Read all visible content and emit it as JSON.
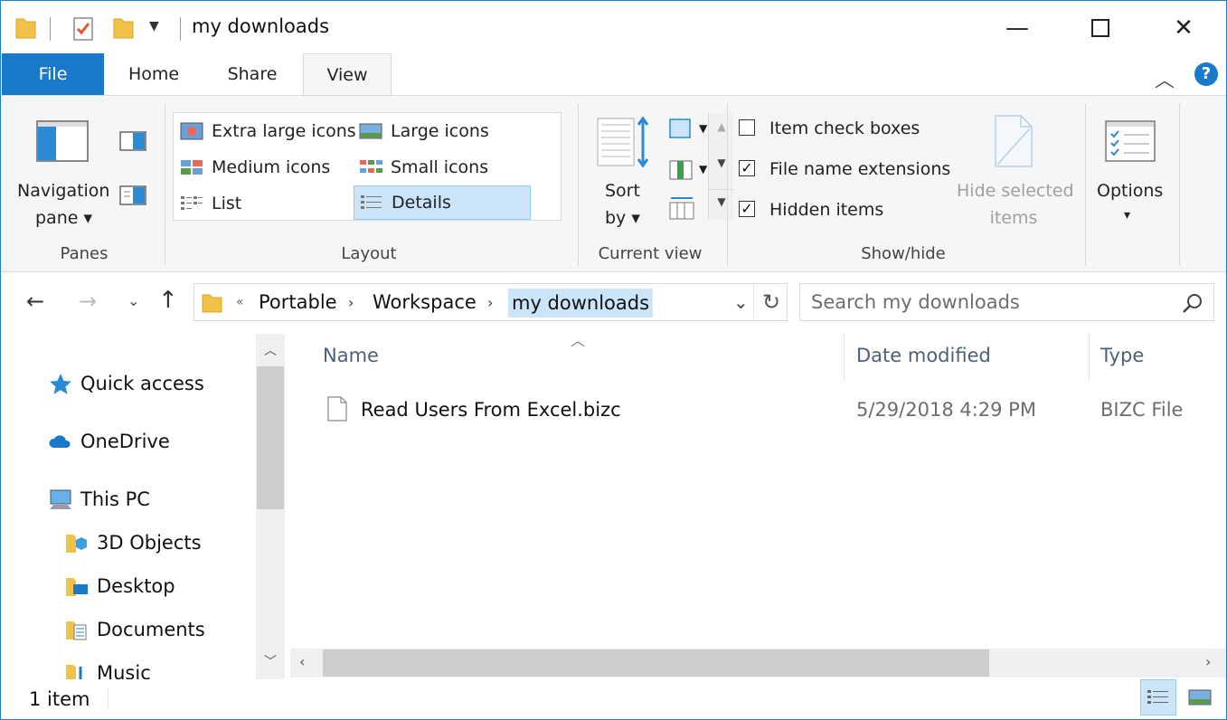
{
  "window": {
    "title": "my downloads",
    "minimize_glyph": "—",
    "maximize_glyph": "☐",
    "close_glyph": "✕"
  },
  "ribbon_tabs": [
    {
      "label": "File"
    },
    {
      "label": "Home"
    },
    {
      "label": "Share"
    },
    {
      "label": "View"
    }
  ],
  "ribbon": {
    "panes": {
      "nav_pane_line1": "Navigation",
      "nav_pane_line2": "pane",
      "group_label": "Panes"
    },
    "layout": {
      "items": [
        {
          "label": "Extra large icons"
        },
        {
          "label": "Large icons"
        },
        {
          "label": "Medium icons"
        },
        {
          "label": "Small icons"
        },
        {
          "label": "List"
        },
        {
          "label": "Details"
        }
      ],
      "selected": "Details",
      "group_label": "Layout"
    },
    "current_view": {
      "sort_line1": "Sort",
      "sort_line2": "by",
      "group_label": "Current view"
    },
    "show_hide": {
      "item_check_boxes": {
        "label": "Item check boxes",
        "checked": false
      },
      "file_name_extensions": {
        "label": "File name extensions",
        "checked": true
      },
      "hidden_items": {
        "label": "Hidden items",
        "checked": true
      },
      "hide_selected_line1": "Hide selected",
      "hide_selected_line2": "items",
      "group_label": "Show/hide"
    },
    "options": {
      "label": "Options"
    }
  },
  "address": {
    "overflow": "«",
    "crumbs": [
      "Portable",
      "Workspace",
      "my downloads"
    ],
    "search_placeholder": "Search my downloads"
  },
  "nav_items": [
    {
      "label": "Quick access"
    },
    {
      "label": "OneDrive"
    },
    {
      "label": "This PC"
    },
    {
      "label": "3D Objects"
    },
    {
      "label": "Desktop"
    },
    {
      "label": "Documents"
    },
    {
      "label": "Music"
    }
  ],
  "columns": {
    "name": "Name",
    "date_modified": "Date modified",
    "type": "Type"
  },
  "files": [
    {
      "name": "Read Users From Excel.bizc",
      "date_modified": "5/29/2018 4:29 PM",
      "type": "BIZC File"
    }
  ],
  "status": {
    "item_count": "1 item"
  },
  "colors": {
    "accent": "#1979ca",
    "selection": "#cce4f7",
    "header_text": "#4c607a"
  }
}
